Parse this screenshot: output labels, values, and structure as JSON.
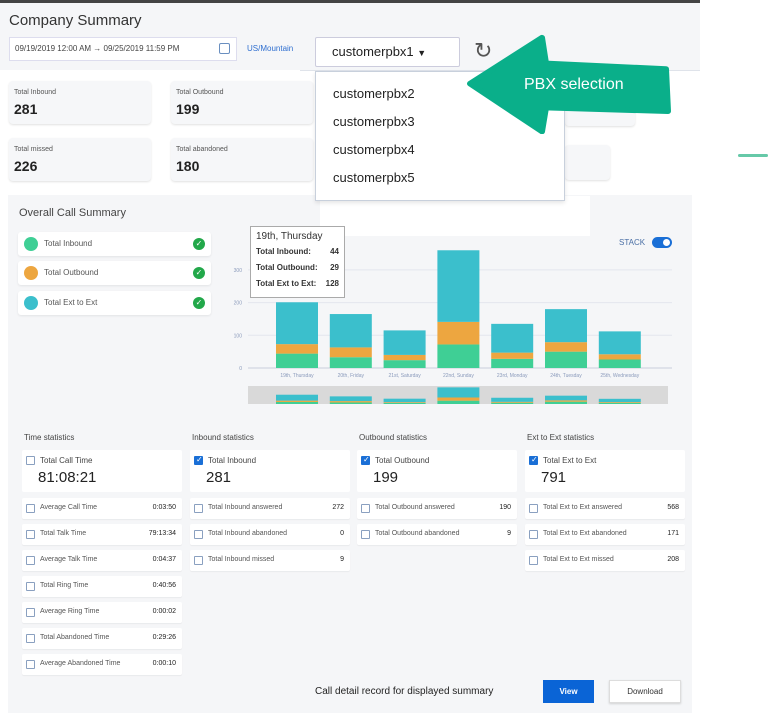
{
  "header": {
    "title": "Company Summary",
    "date_range": "09/19/2019 12:00 AM → 09/25/2019 11:59 PM",
    "timezone": "US/Mountain",
    "calendar_icon": "calendar-icon",
    "refresh_icon": "refresh-icon"
  },
  "pbx": {
    "selected": "customerpbx1",
    "options": [
      "customerpbx2",
      "customerpbx3",
      "customerpbx4",
      "customerpbx5"
    ],
    "callout": "PBX selection",
    "callout_color": "#0aaf8a"
  },
  "summary_cards": [
    {
      "label": "Total Inbound",
      "value": "281"
    },
    {
      "label": "Total Outbound",
      "value": "199"
    },
    {
      "label": "Total missed",
      "value": "226"
    },
    {
      "label": "Total abandoned",
      "value": "180"
    }
  ],
  "overall": {
    "title": "Overall Call Summary",
    "legend": [
      {
        "label": "Total Inbound",
        "color": "#3fcf95"
      },
      {
        "label": "Total Outbound",
        "color": "#eda640"
      },
      {
        "label": "Total Ext to Ext",
        "color": "#3bbfcc"
      }
    ],
    "stack_label": "STACK",
    "stack_on": true
  },
  "tooltip": {
    "title": "19th, Thursday",
    "rows": [
      {
        "label": "Total Inbound:",
        "value": "44"
      },
      {
        "label": "Total Outbound:",
        "value": "29"
      },
      {
        "label": "Total Ext to Ext:",
        "value": "128"
      }
    ]
  },
  "chart_data": {
    "type": "bar",
    "stacked": true,
    "categories": [
      "19th, Thursday",
      "20th, Friday",
      "21st, Saturday",
      "22nd, Sunday",
      "23rd, Monday",
      "24th, Tuesday",
      "25th, Wednesday"
    ],
    "series": [
      {
        "name": "Total Inbound",
        "color": "#3fcf95",
        "values": [
          44,
          33,
          24,
          72,
          28,
          50,
          26
        ]
      },
      {
        "name": "Total Outbound",
        "color": "#eda640",
        "values": [
          29,
          30,
          16,
          69,
          19,
          29,
          16
        ]
      },
      {
        "name": "Total Ext to Ext",
        "color": "#3bbfcc",
        "values": [
          128,
          102,
          75,
          219,
          88,
          101,
          70
        ]
      }
    ],
    "yticks": [
      "0",
      "100",
      "200",
      "300"
    ],
    "ylim": [
      0,
      370
    ],
    "grid": true
  },
  "stats": [
    {
      "title": "Time statistics",
      "main": {
        "label": "Total Call Time",
        "value": "81:08:21",
        "checked": false
      },
      "rows": [
        {
          "label": "Average Call Time",
          "value": "0:03:50"
        },
        {
          "label": "Total Talk Time",
          "value": "79:13:34"
        },
        {
          "label": "Average Talk Time",
          "value": "0:04:37"
        },
        {
          "label": "Total Ring Time",
          "value": "0:40:56"
        },
        {
          "label": "Average Ring Time",
          "value": "0:00:02"
        },
        {
          "label": "Total Abandoned Time",
          "value": "0:29:26"
        },
        {
          "label": "Average Abandoned Time",
          "value": "0:00:10"
        }
      ]
    },
    {
      "title": "Inbound statistics",
      "main": {
        "label": "Total Inbound",
        "value": "281",
        "checked": true
      },
      "rows": [
        {
          "label": "Total Inbound answered",
          "value": "272"
        },
        {
          "label": "Total Inbound abandoned",
          "value": "0"
        },
        {
          "label": "Total Inbound missed",
          "value": "9"
        }
      ]
    },
    {
      "title": "Outbound statistics",
      "main": {
        "label": "Total Outbound",
        "value": "199",
        "checked": true
      },
      "rows": [
        {
          "label": "Total Outbound answered",
          "value": "190"
        },
        {
          "label": "Total Outbound abandoned",
          "value": "9"
        }
      ]
    },
    {
      "title": "Ext to Ext statistics",
      "main": {
        "label": "Total Ext to Ext",
        "value": "791",
        "checked": true
      },
      "rows": [
        {
          "label": "Total Ext to Ext answered",
          "value": "568"
        },
        {
          "label": "Total Ext to Ext abandoned",
          "value": "171"
        },
        {
          "label": "Total Ext to Ext missed",
          "value": "208"
        }
      ]
    }
  ],
  "footer": {
    "cdr_text": "Call detail record for displayed summary",
    "view_label": "View",
    "download_label": "Download"
  }
}
